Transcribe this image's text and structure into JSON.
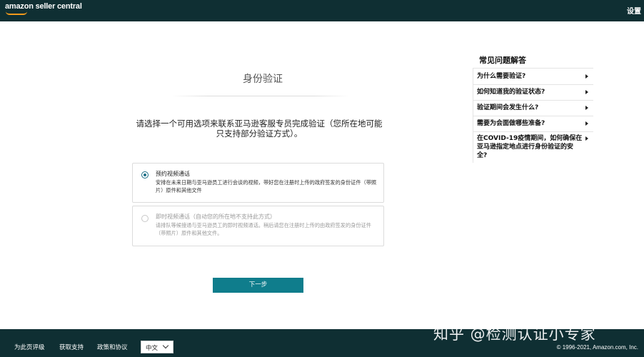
{
  "header": {
    "logo_text": "amazon seller central",
    "settings_label": "设置"
  },
  "main": {
    "title": "身份验证",
    "instruction": "请选择一个可用选项来联系亚马逊客服专员完成验证（您所在地可能只支持部分验证方式）。",
    "options": [
      {
        "title": "预约视频通话",
        "description": "安排在未来日期与亚马逊员工进行会谈的视频，带好您在注册时上传的政府签发的身份证件（带照片）原件和其他文件",
        "selected": true
      },
      {
        "title": "即时视频通话（自动您的所在地不支持此方式）",
        "description": "请排队等候接通与亚马逊员工的即时视频通话。稍后请您在注册时上传的由政府签发的身份证件（带照片）原件和其他文件。",
        "selected": false
      }
    ],
    "next_label": "下一步"
  },
  "faq": {
    "heading": "常见问题解答",
    "items": [
      "为什么需要验证?",
      "如何知道我的验证状态?",
      "验证期间会发生什么?",
      "需要为会面做哪些准备?",
      "在COVID-19疫情期间，如何确保在亚马逊指定地点进行身份验证的安全?"
    ]
  },
  "footer": {
    "links": [
      "为此页评级",
      "获取支持",
      "政策和协议"
    ],
    "language": "中文",
    "copyright": "© 1996-2021, Amazon.com, Inc."
  },
  "watermark": "知乎 @检测认证小专家",
  "colors": {
    "header_bg": "#0f2f33",
    "button_bg": "#0f7d8c",
    "logo_accent": "#f39a1b"
  }
}
